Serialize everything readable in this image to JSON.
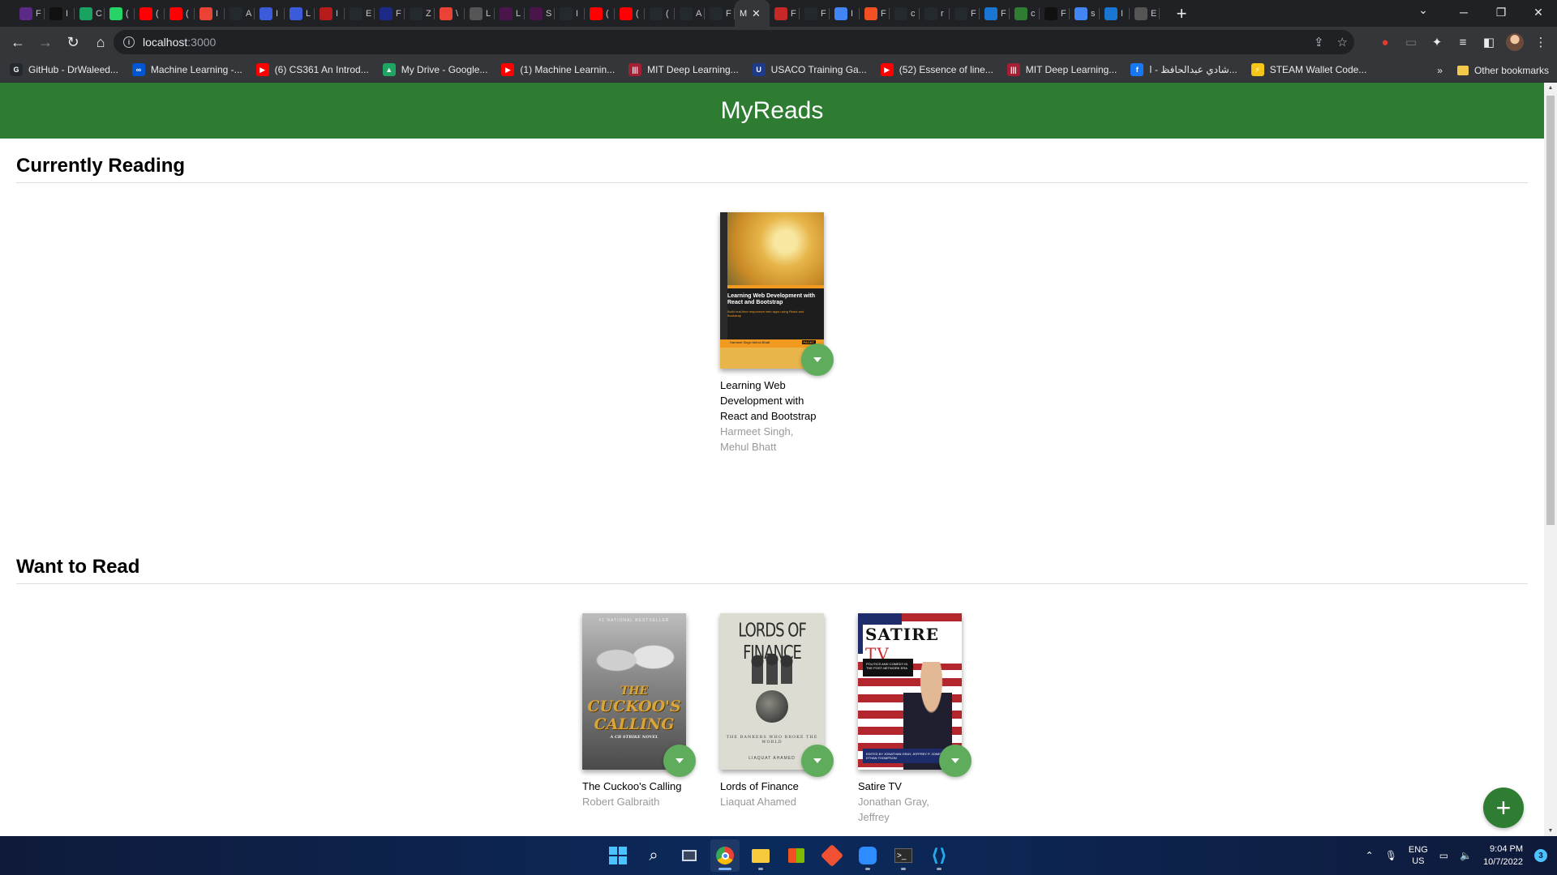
{
  "browser": {
    "tabs": [
      {
        "letter": "F",
        "color": "#5b2a86"
      },
      {
        "letter": "I",
        "color": "#111111"
      },
      {
        "letter": "C",
        "color": "#1aa260"
      },
      {
        "letter": "(",
        "color": "#25d366"
      },
      {
        "letter": "(",
        "color": "#ff0000"
      },
      {
        "letter": "(",
        "color": "#ff0000"
      },
      {
        "letter": "I",
        "color": "#ea4335"
      },
      {
        "letter": "A",
        "color": "#24292e"
      },
      {
        "letter": "I",
        "color": "#3b5bdb"
      },
      {
        "letter": "L",
        "color": "#3b5bdb"
      },
      {
        "letter": "I",
        "color": "#b71c1c"
      },
      {
        "letter": "E",
        "color": "#24292e"
      },
      {
        "letter": "F",
        "color": "#1e2a8a"
      },
      {
        "letter": "Z",
        "color": "#24292e"
      },
      {
        "letter": "\\",
        "color": "#ea4335"
      },
      {
        "letter": "L",
        "color": "#555555"
      },
      {
        "letter": "L",
        "color": "#4a154b"
      },
      {
        "letter": "S",
        "color": "#4a154b"
      },
      {
        "letter": "I",
        "color": "#24292e"
      },
      {
        "letter": "(",
        "color": "#ff0000"
      },
      {
        "letter": "(",
        "color": "#ff0000"
      },
      {
        "letter": "(",
        "color": "#24292e"
      },
      {
        "letter": "A",
        "color": "#24292e"
      },
      {
        "letter": "F",
        "color": "#24292e"
      }
    ],
    "active_tab_title": "M",
    "tabs_after": [
      {
        "letter": "F",
        "color": "#c62828"
      },
      {
        "letter": "F",
        "color": "#24292e"
      },
      {
        "letter": "I",
        "color": "#4285f4"
      },
      {
        "letter": "F",
        "color": "#f25022"
      },
      {
        "letter": "c",
        "color": "#24292e"
      },
      {
        "letter": "r",
        "color": "#24292e"
      },
      {
        "letter": "F",
        "color": "#24292e"
      },
      {
        "letter": "F",
        "color": "#1976d2"
      },
      {
        "letter": "c",
        "color": "#2e7d32"
      },
      {
        "letter": "F",
        "color": "#111111"
      },
      {
        "letter": "s",
        "color": "#4285f4"
      },
      {
        "letter": "I",
        "color": "#1976d2"
      },
      {
        "letter": "E",
        "color": "#555555"
      }
    ],
    "url_host": "localhost",
    "url_port": ":3000",
    "bookmarks": [
      {
        "label": "GitHub - DrWaleed...",
        "color": "#24292e",
        "glyph": "G"
      },
      {
        "label": "Machine Learning -...",
        "color": "#0056d2",
        "glyph": "∞"
      },
      {
        "label": "(6) CS361 An Introd...",
        "color": "#ff0000",
        "glyph": "▶"
      },
      {
        "label": "My Drive - Google...",
        "color": "#1fa463",
        "glyph": "▲"
      },
      {
        "label": "(1) Machine Learnin...",
        "color": "#ff0000",
        "glyph": "▶"
      },
      {
        "label": "MIT Deep Learning...",
        "color": "#a31f34",
        "glyph": "|||"
      },
      {
        "label": "USACO Training Ga...",
        "color": "#1e3a8a",
        "glyph": "U"
      },
      {
        "label": "(52) Essence of line...",
        "color": "#ff0000",
        "glyph": "▶"
      },
      {
        "label": "MIT Deep Learning...",
        "color": "#a31f34",
        "glyph": "|||"
      },
      {
        "label": "شادي عبدالحافظ - ا...",
        "color": "#1877f2",
        "glyph": "f"
      },
      {
        "label": "STEAM Wallet Code...",
        "color": "#f5c518",
        "glyph": "⚡"
      }
    ],
    "other_bookmarks": "Other bookmarks"
  },
  "app": {
    "title": "MyReads",
    "shelves": [
      {
        "title": "Currently Reading",
        "books": [
          {
            "title": "Learning Web Development with React and Bootstrap",
            "authors": "Harmeet Singh, Mehul Bhatt",
            "cover": "react",
            "cover_text": {
              "title": "Learning Web Development with React and Bootstrap",
              "sub": "Build real-time responsive web apps using React and Bootstrap",
              "authors": "Harmeet Singh Mehul Bhatt",
              "publisher": "PACKT"
            }
          }
        ]
      },
      {
        "title": "Want to Read",
        "books": [
          {
            "title": "The Cuckoo's Calling",
            "authors": "Robert Galbraith",
            "cover": "cuckoo",
            "cover_text": {
              "top": "#1 NATIONAL BESTSELLER",
              "t1": "THE",
              "t2": "CUCKOO'S",
              "t3": "CALLING",
              "sub": "A CB STRIKE NOVEL"
            }
          },
          {
            "title": "Lords of Finance",
            "authors": "Liaquat Ahamed",
            "cover": "lords",
            "cover_text": {
              "title": "LORDS OF FINANCE",
              "sub": "THE BANKERS WHO BROKE THE WORLD",
              "author": "LIAQUAT AHAMED"
            }
          },
          {
            "title": "Satire TV",
            "authors": "Jonathan Gray, Jeffrey",
            "cover": "satire",
            "cover_text": {
              "title": "SATIRE",
              "tv": "TV",
              "sub": "POLITICS AND COMEDY IN THE POST-NETWORK ERA",
              "bottom": "EDITED BY JONATHAN GRAY, JEFFREY P. JONES, AND ETHAN THOMPSON"
            }
          }
        ]
      }
    ],
    "add_button": "+"
  },
  "taskbar": {
    "lang_top": "ENG",
    "lang_bottom": "US",
    "time": "9:04 PM",
    "date": "10/7/2022",
    "notif_count": "3"
  }
}
